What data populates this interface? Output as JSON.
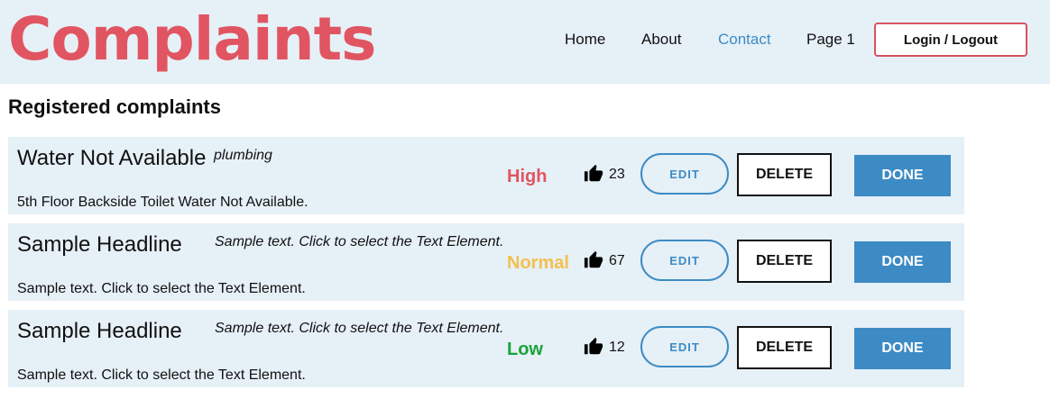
{
  "app": {
    "title": "Complaints"
  },
  "nav": {
    "items": [
      {
        "label": "Home"
      },
      {
        "label": "About"
      },
      {
        "label": "Contact"
      },
      {
        "label": "Page 1"
      }
    ],
    "login_label": "Login / Logout"
  },
  "colors": {
    "brand": "#e05561",
    "accent": "#3d8bc4",
    "high": "#e05561",
    "normal": "#f2c14e",
    "low": "#1aa33a"
  },
  "main": {
    "title": "Registered complaints",
    "complaints": [
      {
        "headline": "Water Not Available",
        "category": "plumbing",
        "description": "5th Floor Backside Toilet Water Not Available.",
        "priority": "High",
        "likes": "23",
        "edit_label": "EDIT",
        "delete_label": "DELETE",
        "done_label": "DONE"
      },
      {
        "headline": "Sample Headline",
        "category": "Sample text. Click to select the Text Element.",
        "description": "Sample text. Click to select the Text Element.",
        "priority": "Normal",
        "likes": "67",
        "edit_label": "EDIT",
        "delete_label": "DELETE",
        "done_label": "DONE"
      },
      {
        "headline": "Sample Headline",
        "category": "Sample text. Click to select the Text Element.",
        "description": "Sample text. Click to select the Text Element.",
        "priority": "Low",
        "likes": "12",
        "edit_label": "EDIT",
        "delete_label": "DELETE",
        "done_label": "DONE"
      }
    ]
  },
  "icons": {
    "like": "thumbs-up-icon"
  }
}
